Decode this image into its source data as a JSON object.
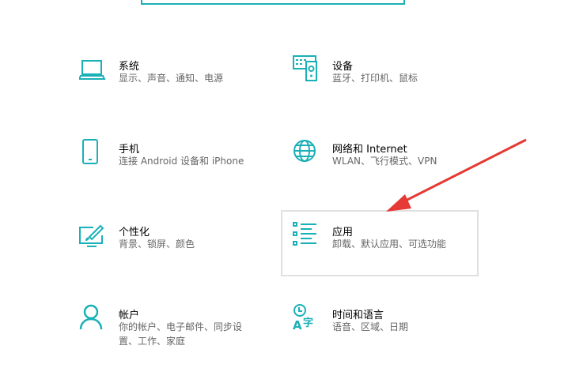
{
  "accent": "#1ab0b8",
  "items": [
    {
      "title": "系统",
      "sub": "显示、声音、通知、电源",
      "icon": "laptop-icon"
    },
    {
      "title": "设备",
      "sub": "蓝牙、打印机、鼠标",
      "icon": "devices-icon"
    },
    {
      "title": "手机",
      "sub": "连接 Android 设备和 iPhone",
      "icon": "phone-icon"
    },
    {
      "title": "网络和 Internet",
      "sub": "WLAN、飞行模式、VPN",
      "icon": "globe-icon"
    },
    {
      "title": "个性化",
      "sub": "背景、锁屏、颜色",
      "icon": "personalization-icon"
    },
    {
      "title": "应用",
      "sub": "卸载、默认应用、可选功能",
      "icon": "apps-list-icon"
    },
    {
      "title": "帐户",
      "sub": "你的帐户、电子邮件、同步设置、工作、家庭",
      "icon": "person-icon"
    },
    {
      "title": "时间和语言",
      "sub": "语音、区域、日期",
      "icon": "time-language-icon"
    }
  ]
}
